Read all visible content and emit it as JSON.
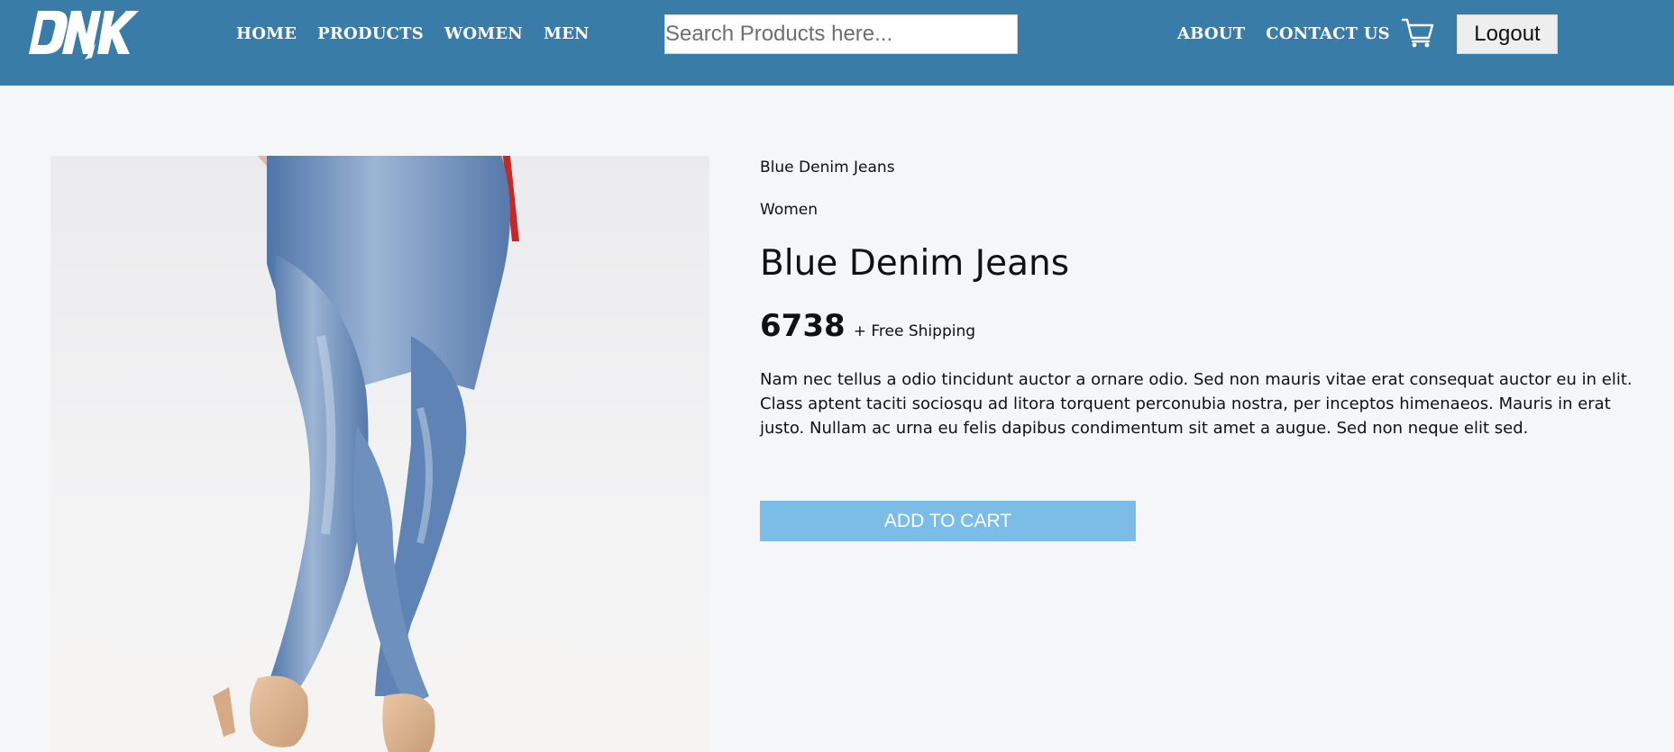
{
  "brand": {
    "logo_text": "DNK"
  },
  "nav": {
    "left": [
      {
        "label": "HOME"
      },
      {
        "label": "PRODUCTS"
      },
      {
        "label": "WOMEN"
      },
      {
        "label": "MEN"
      }
    ],
    "right": [
      {
        "label": "ABOUT"
      },
      {
        "label": "CONTACT US"
      }
    ],
    "search_placeholder": "Search Products here...",
    "cart_icon": "cart-icon",
    "logout_label": "Logout"
  },
  "product": {
    "breadcrumb_name": "Blue Denim Jeans",
    "category": "Women",
    "title": "Blue Denim Jeans",
    "price": "6738",
    "shipping": "+ Free Shipping",
    "description": "Nam nec tellus a odio tincidunt auctor a ornare odio. Sed non mauris vitae erat consequat auctor eu in elit. Class aptent taciti sociosqu ad litora torquent perconubia nostra, per inceptos himenaeos. Mauris in erat justo. Nullam ac urna eu felis dapibus condimentum sit amet a augue. Sed non neque elit sed.",
    "add_to_cart_label": "ADD TO CART",
    "image_icon": "jeans-photo"
  },
  "colors": {
    "navbar": "#3a7ca8",
    "button": "#7bbde6",
    "page_bg": "#f5f6f8"
  }
}
